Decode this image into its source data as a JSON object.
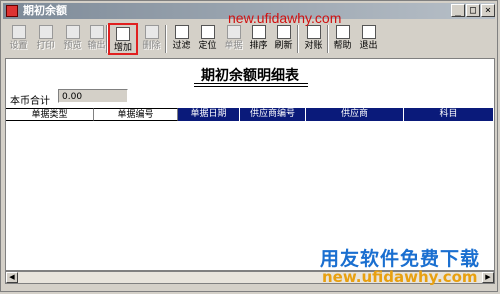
{
  "window": {
    "title": "期初余额",
    "controls": {
      "minimize": "_",
      "maximize": "□",
      "close": "×"
    }
  },
  "watermark_top": "new.ufidawhy.com",
  "toolbar": {
    "buttons": [
      {
        "label": "设置",
        "icon": "settings-icon",
        "enabled": false
      },
      {
        "label": "打印",
        "icon": "print-icon",
        "enabled": false
      },
      {
        "label": "预览",
        "icon": "preview-icon",
        "enabled": false
      },
      {
        "label": "输出",
        "icon": "export-icon",
        "enabled": false
      },
      {
        "label": "增加",
        "icon": "add-icon",
        "enabled": true,
        "highlighted": true
      },
      {
        "label": "删除",
        "icon": "delete-icon",
        "enabled": false
      },
      {
        "label": "过滤",
        "icon": "filter-icon",
        "enabled": true
      },
      {
        "label": "定位",
        "icon": "locate-icon",
        "enabled": true
      },
      {
        "label": "单据",
        "icon": "document-icon",
        "enabled": false
      },
      {
        "label": "排序",
        "icon": "sort-icon",
        "enabled": true
      },
      {
        "label": "刷新",
        "icon": "refresh-icon",
        "enabled": true
      },
      {
        "label": "对账",
        "icon": "reconcile-icon",
        "enabled": true
      },
      {
        "label": "帮助",
        "icon": "help-icon",
        "enabled": true
      },
      {
        "label": "退出",
        "icon": "exit-icon",
        "enabled": true
      }
    ]
  },
  "report": {
    "title": "期初余额明细表",
    "total_label": "本币合计",
    "total_value": "0.00",
    "columns": [
      "单据类型",
      "单据编号",
      "单据日期",
      "供应商编号",
      "供应商",
      "科目"
    ]
  },
  "watermark_cn": "用友软件免费下载",
  "watermark_url": "new.ufidawhy.com",
  "colors": {
    "highlight": "#e02020",
    "grid_header_dark": "#0a1a7a",
    "watermark_blue": "#1a6fd0",
    "watermark_orange": "#e8a010"
  }
}
